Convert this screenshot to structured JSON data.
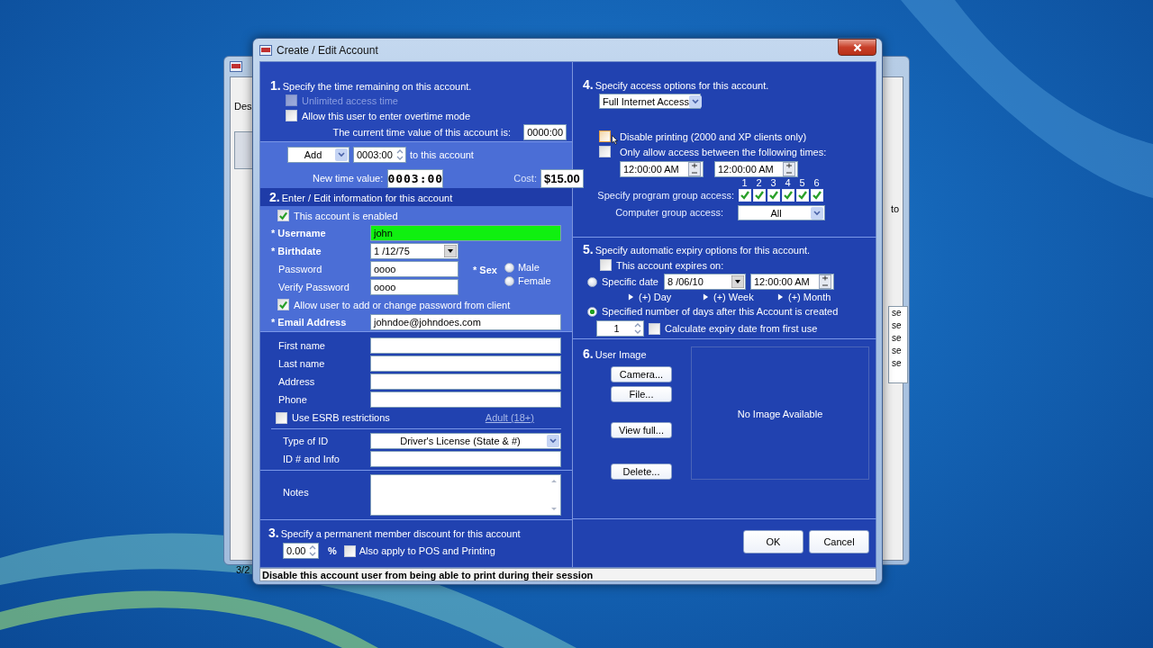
{
  "back_window": {
    "left_texts": [
      "Des",
      "3/2"
    ],
    "right_texts": [
      "to",
      "se",
      "se",
      "se",
      "se",
      "se"
    ]
  },
  "window": {
    "title": "Create / Edit Account"
  },
  "section1": {
    "number": "1.",
    "title": "Specify the time remaining on this account.",
    "options": [
      {
        "label": "Unlimited access time",
        "checked": false,
        "disabled": true
      },
      {
        "label": "Allow this user to enter overtime mode",
        "checked": false,
        "disabled": false
      }
    ],
    "current_label": "The current time value of this account is:",
    "current_value": "0000:00",
    "action": "Add",
    "amount": "0003:00",
    "amount_suffix": "to this account",
    "new_label": "New time value:",
    "new_value": "0003:00",
    "cost_label": "Cost:",
    "cost_value": "$15.00"
  },
  "section2": {
    "number": "2.",
    "title": "Enter / Edit information for this account",
    "enabled": {
      "label": "This account is enabled",
      "checked": true
    },
    "username": {
      "label": "* Username",
      "value": "john",
      "valid": true
    },
    "birthdate": {
      "label": "* Birthdate",
      "value": "1 /12/75"
    },
    "password": {
      "label": "Password",
      "value": "oooo"
    },
    "verify_password": {
      "label": "Verify Password",
      "value": "oooo"
    },
    "sex": {
      "label": "* Sex",
      "options": [
        {
          "label": "Male",
          "selected": false
        },
        {
          "label": "Female",
          "selected": false
        }
      ]
    },
    "allow_password_change": {
      "label": "Allow user to add or change password from client",
      "checked": true
    },
    "email": {
      "label": "* Email Address",
      "value": "johndoe@johndoes.com"
    },
    "personal": [
      {
        "label": "First name"
      },
      {
        "label": "Last name"
      },
      {
        "label": "Address"
      },
      {
        "label": "Phone"
      }
    ],
    "esrb": {
      "label": "Use ESRB restrictions",
      "checked": false,
      "rating": "Adult (18+)"
    },
    "id_type": {
      "label": "Type of ID",
      "value": "Driver's License (State & #)"
    },
    "id_info": {
      "label": "ID # and Info"
    },
    "notes": {
      "label": "Notes"
    }
  },
  "section3": {
    "number": "3.",
    "title": "Specify a permanent member discount for this account",
    "discount": "0.00",
    "percent": "%",
    "also_apply": {
      "label": "Also apply to POS and Printing",
      "checked": false
    }
  },
  "section4": {
    "number": "4.",
    "title": "Specify access options for this account.",
    "access": "Full Internet Access",
    "options": [
      {
        "label": "Disable printing (2000 and XP clients only)",
        "checked": false,
        "hovered": true
      },
      {
        "label": "Only allow access between the following times:",
        "checked": false,
        "hovered": false
      }
    ],
    "times": [
      "12:00:00 AM",
      "12:00:00 AM"
    ],
    "program_group_label": "Specify program group access:",
    "program_groups": [
      {
        "label": "1",
        "checked": true
      },
      {
        "label": "2",
        "checked": true
      },
      {
        "label": "3",
        "checked": true
      },
      {
        "label": "4",
        "checked": true
      },
      {
        "label": "5",
        "checked": true
      },
      {
        "label": "6",
        "checked": true
      }
    ],
    "computer_group_label": "Computer group access:",
    "computer_group": "All"
  },
  "section5": {
    "number": "5.",
    "title": "Specify automatic expiry options for this account.",
    "expires": {
      "label": "This account expires on:",
      "checked": false
    },
    "specific": {
      "label": "Specific date",
      "selected": false,
      "date": "8 /06/10",
      "time": "12:00:00 AM"
    },
    "increments": [
      "(+) Day",
      "(+) Week",
      "(+) Month"
    ],
    "days": {
      "label": "Specified number of days after this Account is created",
      "selected": true,
      "value": "1"
    },
    "first_use": {
      "label": "Calculate expiry date from first use",
      "checked": false
    }
  },
  "section6": {
    "number": "6.",
    "title": "User Image",
    "buttons": [
      "Camera...",
      "File...",
      "View full...",
      "Delete..."
    ],
    "placeholder": "No Image Available"
  },
  "buttons": [
    "OK",
    "Cancel"
  ],
  "status_bar": "Disable this account user from being able to print during their session"
}
